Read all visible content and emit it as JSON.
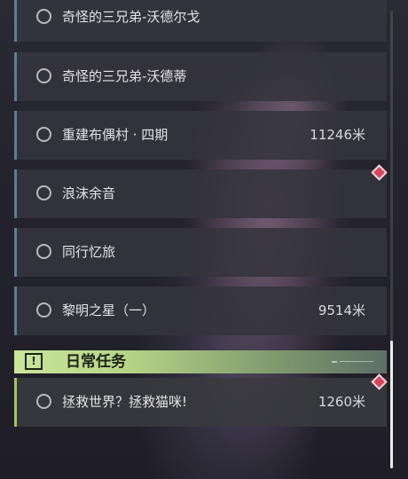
{
  "quests": [
    {
      "name": "奇怪的三兄弟-沃德尔戈",
      "distance": ""
    },
    {
      "name": "奇怪的三兄弟-沃德蒂",
      "distance": ""
    },
    {
      "name": "重建布偶村 · 四期",
      "distance": "11246米"
    },
    {
      "name": "浪沫余音",
      "distance": ""
    },
    {
      "name": "同行忆旅",
      "distance": ""
    },
    {
      "name": "黎明之星（一）",
      "distance": "9514米"
    }
  ],
  "daily_section": {
    "title": "日常任务",
    "icon": "!",
    "quests": [
      {
        "name": "拯救世界？拯救猫咪!",
        "distance": "1260米"
      }
    ]
  },
  "colors": {
    "accent_daily": "#b6d487",
    "marker": "#d9455a",
    "row_border": "#5f7d8f"
  },
  "icons": [
    "circle-icon",
    "alert-icon",
    "waypoint-marker-icon"
  ]
}
